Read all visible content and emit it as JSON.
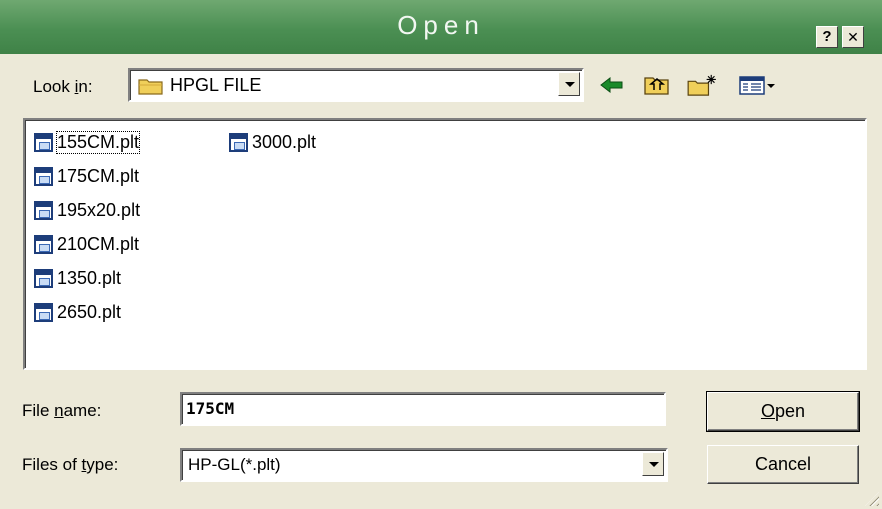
{
  "window": {
    "title": "Open",
    "help_glyph": "?",
    "close_glyph": "✕"
  },
  "look_in": {
    "label_pre": "Look ",
    "label_u": "i",
    "label_post": "n:",
    "value": "HPGL FILE"
  },
  "toolbar": {
    "icons": [
      "back-arrow-icon",
      "up-folder-icon",
      "new-folder-icon",
      "view-menu-icon"
    ]
  },
  "files": {
    "column1": [
      {
        "name": "155CM.plt",
        "selected": true
      },
      {
        "name": "175CM.plt",
        "selected": false
      },
      {
        "name": "195x20.plt",
        "selected": false
      },
      {
        "name": "210CM.plt",
        "selected": false
      },
      {
        "name": "1350.plt",
        "selected": false
      },
      {
        "name": "2650.plt",
        "selected": false
      }
    ],
    "column2": [
      {
        "name": "3000.plt",
        "selected": false
      }
    ]
  },
  "file_name": {
    "label_pre": "File ",
    "label_u": "n",
    "label_post": "ame:",
    "value": "175CM"
  },
  "file_type": {
    "label_pre": "Files of ",
    "label_u": "t",
    "label_post": "ype:",
    "value": "HP-GL(*.plt)"
  },
  "buttons": {
    "open_u": "O",
    "open_rest": "pen",
    "cancel": "Cancel"
  },
  "colors": {
    "titlebar": "#4b8f53",
    "face": "#ECE9D8",
    "arrow": "#1a8a2a",
    "folder": "#f0cf5a"
  }
}
